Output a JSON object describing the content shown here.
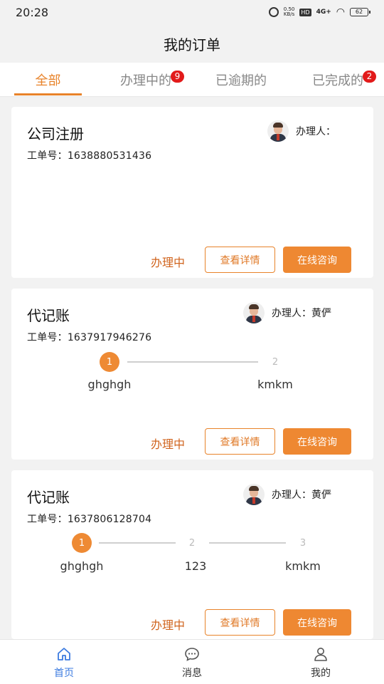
{
  "status_bar": {
    "time": "20:28",
    "speed_value": "0.50",
    "speed_unit": "KB/s",
    "hd": "HD",
    "signal": "4G+",
    "battery": "62"
  },
  "header": {
    "title": "我的订单"
  },
  "tabs": [
    {
      "label": "全部",
      "active": true
    },
    {
      "label": "办理中的",
      "badge": "9"
    },
    {
      "label": "已逾期的"
    },
    {
      "label": "已完成的",
      "badge": "2"
    }
  ],
  "orders": [
    {
      "title": "公司注册",
      "order_no_label": "工单号：",
      "order_no": "1638880531436",
      "handler_label": "办理人：",
      "handler_name": "",
      "status": "办理中",
      "btn_details": "查看详情",
      "btn_consult": "在线咨询"
    },
    {
      "title": "代记账",
      "order_no_label": "工单号：",
      "order_no": "1637917946276",
      "handler_label": "办理人：",
      "handler_name": "黄俨",
      "steps": [
        {
          "num": "1",
          "label": "ghghgh",
          "active": true
        },
        {
          "num": "2",
          "label": "kmkm",
          "active": false
        }
      ],
      "status": "办理中",
      "btn_details": "查看详情",
      "btn_consult": "在线咨询"
    },
    {
      "title": "代记账",
      "order_no_label": "工单号：",
      "order_no": "1637806128704",
      "handler_label": "办理人：",
      "handler_name": "黄俨",
      "steps": [
        {
          "num": "1",
          "label": "ghghgh",
          "active": true
        },
        {
          "num": "2",
          "label": "123",
          "active": false
        },
        {
          "num": "3",
          "label": "kmkm",
          "active": false
        }
      ],
      "status": "办理中",
      "btn_details": "查看详情",
      "btn_consult": "在线咨询"
    }
  ],
  "bottom_nav": [
    {
      "label": "首页",
      "icon": "home-icon",
      "active": true
    },
    {
      "label": "消息",
      "icon": "message-icon"
    },
    {
      "label": "我的",
      "icon": "user-icon"
    }
  ],
  "colors": {
    "accent": "#ee8832",
    "badge": "#e21a1a",
    "nav_active": "#3c7be0",
    "status": "#d0641e"
  }
}
